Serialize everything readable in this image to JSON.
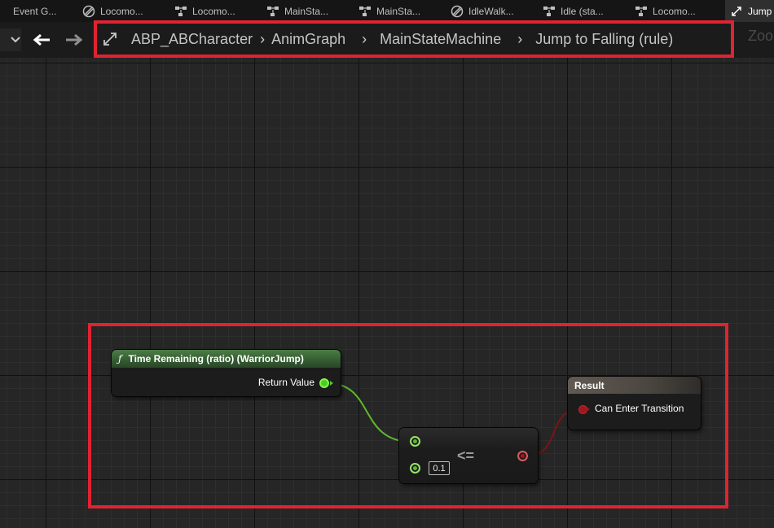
{
  "tabs": [
    {
      "label": "Event G...",
      "icon": "event-graph-icon",
      "active": false
    },
    {
      "label": "Locomo...",
      "icon": "state-machine-icon",
      "active": false
    },
    {
      "label": "Locomo...",
      "icon": "state-machine-icon",
      "active": false
    },
    {
      "label": "MainSta...",
      "icon": "state-machine-icon",
      "active": false
    },
    {
      "label": "MainSta...",
      "icon": "state-machine-icon",
      "active": false
    },
    {
      "label": "IdleWalk...",
      "icon": "blendspace-icon",
      "active": false
    },
    {
      "label": "Idle (sta...",
      "icon": "state-machine-icon",
      "active": false
    },
    {
      "label": "Locomo...",
      "icon": "state-machine-icon",
      "active": false
    },
    {
      "label": "Jump",
      "icon": "transition-icon",
      "active": true
    }
  ],
  "breadcrumb": {
    "root": "ABP_ABCharacter",
    "items": [
      "AnimGraph",
      "MainStateMachine",
      "Jump to Falling (rule)"
    ]
  },
  "zoom_label": "Zoo",
  "nodes": {
    "time_remaining": {
      "title": "Time Remaining (ratio) (WarriorJump)",
      "output_label": "Return Value"
    },
    "compare": {
      "operator": "<=",
      "literal_value": "0.1"
    },
    "result": {
      "title": "Result",
      "input_label": "Can Enter Transition"
    }
  },
  "colors": {
    "highlight": "#e02331",
    "float_pin": "#7ee03f",
    "bool_pin": "#a1151d",
    "function_header": "#3a6636",
    "result_header": "#4e4a44"
  }
}
